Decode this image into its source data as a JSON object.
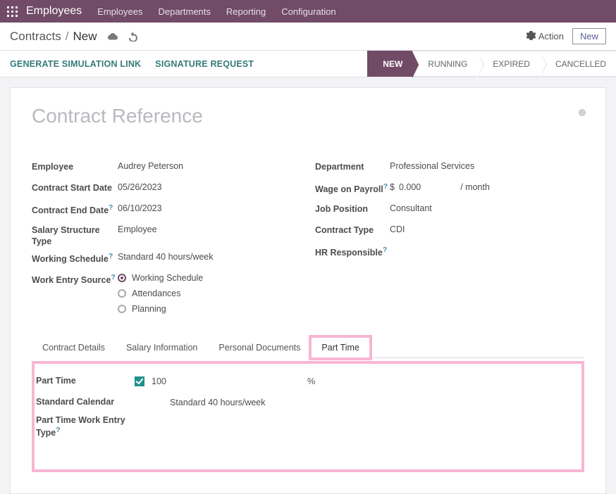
{
  "nav": {
    "brand": "Employees",
    "items": [
      "Employees",
      "Departments",
      "Reporting",
      "Configuration"
    ]
  },
  "breadcrumb": {
    "root": "Contracts",
    "sep": "/",
    "current": "New"
  },
  "controls": {
    "action": "Action",
    "new": "New"
  },
  "secondary": {
    "simulation": "GENERATE SIMULATION LINK",
    "signature": "SIGNATURE REQUEST"
  },
  "status": {
    "steps": [
      "NEW",
      "RUNNING",
      "EXPIRED",
      "CANCELLED"
    ],
    "active": "NEW"
  },
  "title_placeholder": "Contract Reference",
  "left": {
    "employee_label": "Employee",
    "employee": "Audrey Peterson",
    "start_label": "Contract Start Date",
    "start": "05/26/2023",
    "end_label": "Contract End Date",
    "end": "06/10/2023",
    "structure_label": "Salary Structure Type",
    "structure": "Employee",
    "schedule_label": "Working Schedule",
    "schedule": "Standard 40 hours/week",
    "work_entry_label": "Work Entry Source",
    "work_entry_options": [
      "Working Schedule",
      "Attendances",
      "Planning"
    ],
    "work_entry_selected": "Working Schedule"
  },
  "right": {
    "department_label": "Department",
    "department": "Professional Services",
    "wage_label": "Wage on Payroll",
    "wage_currency": "$",
    "wage_value": "0.000",
    "wage_period": "/ month",
    "position_label": "Job Position",
    "position": "Consultant",
    "ctype_label": "Contract Type",
    "ctype": "CDI",
    "hr_label": "HR Responsible",
    "hr": ""
  },
  "tabs": {
    "items": [
      "Contract Details",
      "Salary Information",
      "Personal Documents",
      "Part Time"
    ],
    "active": "Part Time"
  },
  "panel": {
    "parttime_label": "Part Time",
    "parttime_checked": true,
    "parttime_value": "100",
    "percent_sign": "%",
    "std_cal_label": "Standard Calendar",
    "std_cal_value": "Standard 40 hours/week",
    "ptwet_label": "Part Time Work Entry Type",
    "ptwet_value": ""
  },
  "help_marker": "?"
}
